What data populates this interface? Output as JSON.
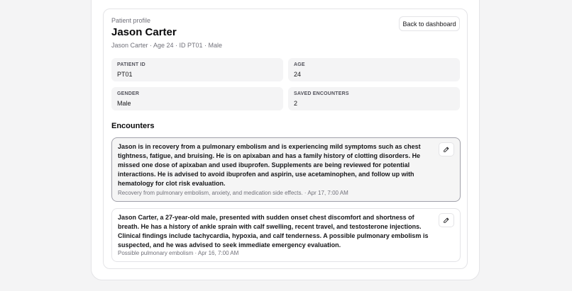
{
  "profile": {
    "eyebrow": "Patient profile",
    "name": "Jason Carter",
    "meta": "Jason Carter · Age 24 · ID PT01 · Male",
    "back_label": "Back to dashboard"
  },
  "fields": [
    {
      "label": "PATIENT ID",
      "value": "PT01"
    },
    {
      "label": "AGE",
      "value": "24"
    },
    {
      "label": "GENDER",
      "value": "Male"
    },
    {
      "label": "SAVED ENCOUNTERS",
      "value": "2"
    }
  ],
  "encounters": {
    "title": "Encounters",
    "items": [
      {
        "text": "Jason is in recovery from a pulmonary embolism and is experiencing mild symptoms such as chest tightness, fatigue, and bruising. He is on apixaban and has a family history of clotting disorders. He missed one dose of apixaban and used ibuprofen. Supplements are being reviewed for potential interactions. He is advised to avoid ibuprofen and aspirin, use acetaminophen, and follow up with hematology for clot risk evaluation.",
        "meta": "Recovery from pulmonary embolism, anxiety, and medication side effects. · Apr 17, 7:00 AM",
        "edit_icon": "pencil-icon"
      },
      {
        "text": "Jason Carter, a 27-year-old male, presented with sudden onset chest discomfort and shortness of breath. He has a history of ankle sprain with calf swelling, recent travel, and testosterone injections. Clinical findings include tachycardia, hypoxia, and calf tenderness. A possible pulmonary embolism is suspected, and he was advised to seek immediate emergency evaluation.",
        "meta": "Possible pulmonary embolism · Apr 16, 7:00 AM",
        "edit_icon": "pencil-icon"
      }
    ]
  },
  "colors": {
    "background": "#f4f4f5",
    "card": "#ffffff",
    "field_bg": "#f4f4f5",
    "selected_bg": "#f5f5f5",
    "muted_text": "#71717a"
  }
}
